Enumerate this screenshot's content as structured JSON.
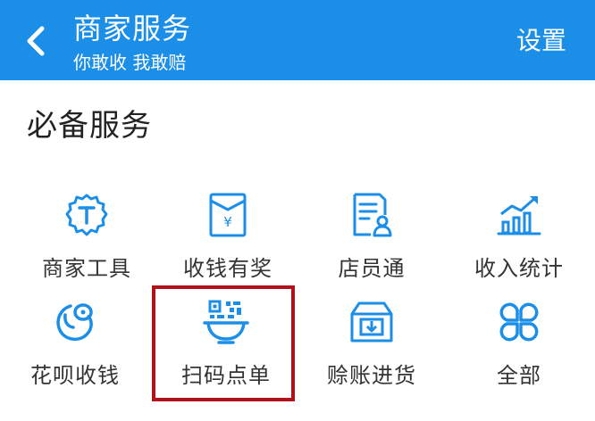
{
  "header": {
    "back_icon": "chevron-left-icon",
    "title": "商家服务",
    "subtitle": "你敢收 我敢赔",
    "settings_label": "设置",
    "background_color": "#1b8ee8"
  },
  "section": {
    "title": "必备服务"
  },
  "services": [
    {
      "label": "商家工具",
      "icon": "merchant-tools-icon"
    },
    {
      "label": "收钱有奖",
      "icon": "red-envelope-icon"
    },
    {
      "label": "店员通",
      "icon": "clerk-document-icon"
    },
    {
      "label": "收入统计",
      "icon": "bar-chart-icon"
    },
    {
      "label": "花呗收钱",
      "icon": "huabei-icon"
    },
    {
      "label": "扫码点单",
      "icon": "qr-bowl-icon"
    },
    {
      "label": "赊账进货",
      "icon": "inbox-download-icon"
    },
    {
      "label": "全部",
      "icon": "four-leaf-grid-icon"
    }
  ],
  "colors": {
    "icon_blue": "#1b8ee8",
    "highlight_red": "#b0121b"
  }
}
